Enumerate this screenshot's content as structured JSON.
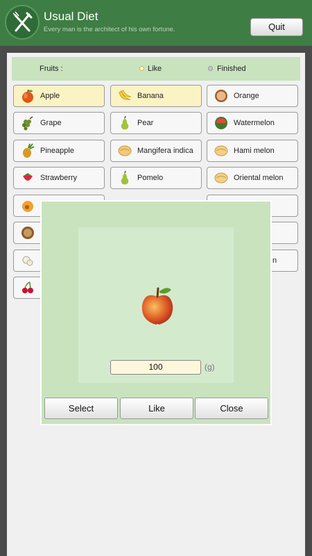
{
  "header": {
    "title": "Usual Diet",
    "subtitle": "Every man is the architect of his own fortune.",
    "quit_label": "Quit"
  },
  "filter": {
    "category_label": "Fruits :",
    "like_label": "Like",
    "finished_label": "Finished"
  },
  "items": [
    {
      "label": "Apple",
      "icon": "apple-icon",
      "liked": true
    },
    {
      "label": "Banana",
      "icon": "banana-icon",
      "liked": true
    },
    {
      "label": "Orange",
      "icon": "orange-icon",
      "liked": false
    },
    {
      "label": "Grape",
      "icon": "grape-icon",
      "liked": false
    },
    {
      "label": "Pear",
      "icon": "pear-icon",
      "liked": false
    },
    {
      "label": "Watermelon",
      "icon": "watermelon-icon",
      "liked": false
    },
    {
      "label": "Pineapple",
      "icon": "pineapple-icon",
      "liked": false
    },
    {
      "label": "Mangifera indica",
      "icon": "mango-icon",
      "liked": false
    },
    {
      "label": "Hami melon",
      "icon": "melon-icon",
      "liked": false
    },
    {
      "label": "Strawberry",
      "icon": "strawberry-icon",
      "liked": false
    },
    {
      "label": "Pomelo",
      "icon": "pomelo-icon",
      "liked": false
    },
    {
      "label": "Oriental melon",
      "icon": "melon-icon",
      "liked": false
    }
  ],
  "partial_row_labels": {
    "row6_col3_suffix": "n"
  },
  "dialog": {
    "image": "apple-icon",
    "amount": "100",
    "unit": "(g)",
    "select_label": "Select",
    "like_label": "Like",
    "close_label": "Close"
  },
  "colors": {
    "header": "#3e7d44",
    "panel_green": "#c8e3be",
    "liked_item": "#fbf3c4"
  }
}
